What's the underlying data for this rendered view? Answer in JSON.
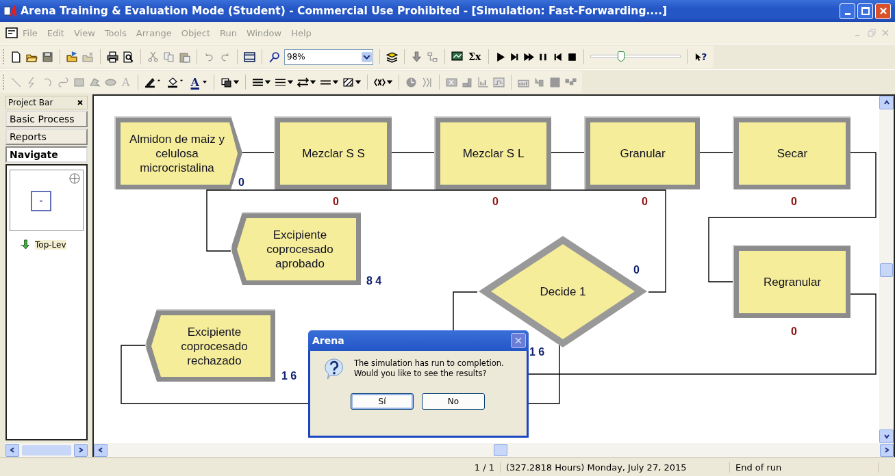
{
  "window": {
    "title": "Arena Training & Evaluation Mode (Student) - Commercial Use Prohibited - [Simulation: Fast-Forwarding....]"
  },
  "menu": [
    {
      "label": "File",
      "disabled": true
    },
    {
      "label": "Edit",
      "disabled": true
    },
    {
      "label": "View",
      "disabled": true
    },
    {
      "label": "Tools",
      "disabled": true
    },
    {
      "label": "Arrange",
      "disabled": true
    },
    {
      "label": "Object",
      "disabled": true
    },
    {
      "label": "Run",
      "disabled": true
    },
    {
      "label": "Window",
      "disabled": true
    },
    {
      "label": "Help",
      "disabled": true
    }
  ],
  "standard_toolbar": {
    "zoom": "98%",
    "sigma_tool": "Σx",
    "help_tool": "?",
    "speed_slider": {
      "level": 0.33
    }
  },
  "draw_toolbar": {
    "text_tool": "A",
    "text_color_tool": "A"
  },
  "project_bar": {
    "title": "Project Bar",
    "tabs": [
      {
        "label": "Basic Process",
        "selected": false
      },
      {
        "label": "Reports",
        "selected": false
      },
      {
        "label": "Navigate",
        "selected": true
      }
    ],
    "tree": [
      {
        "label": "Top-Lev"
      }
    ]
  },
  "model": {
    "nodes": [
      {
        "kind": "create",
        "label": "Almidon de maiz y celulosa microcristalina",
        "counters": [
          "0"
        ]
      },
      {
        "kind": "process",
        "label": "Mezclar S S",
        "counters": [
          "0"
        ]
      },
      {
        "kind": "process",
        "label": "Mezclar S L",
        "counters": [
          "0"
        ]
      },
      {
        "kind": "process",
        "label": "Granular",
        "counters": [
          "0"
        ]
      },
      {
        "kind": "process",
        "label": "Secar",
        "counters": [
          "0"
        ]
      },
      {
        "kind": "dispose",
        "label": "Excipiente coprocesado aprobado",
        "counters": [
          "8 4"
        ]
      },
      {
        "kind": "decide",
        "label": "Decide 1",
        "counters": [
          "0",
          "1 6"
        ]
      },
      {
        "kind": "process",
        "label": "Regranular",
        "counters": [
          "0"
        ]
      },
      {
        "kind": "dispose",
        "label": "Excipiente coprocesado rechazado",
        "counters": [
          "1 6"
        ]
      }
    ]
  },
  "dialog": {
    "title": "Arena",
    "message": [
      "The simulation has run to completion.",
      "Would you like to see the results?"
    ],
    "buttons": [
      {
        "label": "Sí",
        "selected": true
      },
      {
        "label": "No",
        "selected": false
      }
    ]
  },
  "status_bar": {
    "page": "1 / 1",
    "time": "(327.2818 Hours) Monday, July 27, 2015",
    "state": "End of run"
  }
}
